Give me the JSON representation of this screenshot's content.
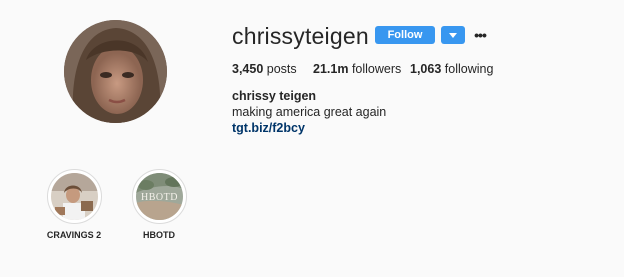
{
  "profile": {
    "username": "chrissyteigen",
    "verified": true,
    "follow_label": "Follow",
    "more_label": "•••",
    "stats": {
      "posts_count": "3,450",
      "posts_label": "posts",
      "followers_count": "21.1m",
      "followers_label": "followers",
      "following_count": "1,063",
      "following_label": "following"
    },
    "full_name": "chrissy teigen",
    "bio": "making america great again",
    "link": "tgt.biz/f2bcy"
  },
  "highlights": [
    {
      "label": "CRAVINGS 2"
    },
    {
      "label": "HBOTD",
      "cover_text": "HBOTD"
    }
  ],
  "colors": {
    "accent": "#3897f0",
    "link": "#003569",
    "background": "#fafafa"
  },
  "icons": [
    "verified-badge-icon",
    "chevron-down-icon",
    "more-options-icon"
  ]
}
